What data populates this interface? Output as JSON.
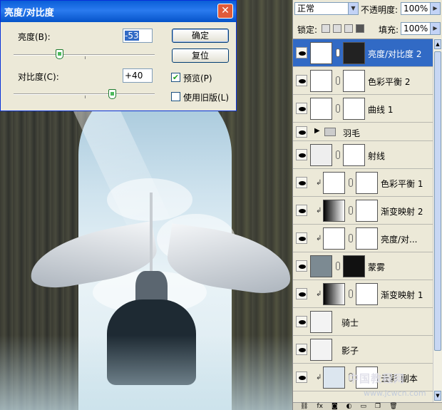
{
  "dialog": {
    "title": "亮度/对比度",
    "close_glyph": "✕",
    "brightness_label": "亮度(B):",
    "brightness_value": "-53",
    "contrast_label": "对比度(C):",
    "contrast_value": "+40",
    "ok_label": "确定",
    "reset_label": "复位",
    "preview_label": "预览(P)",
    "preview_checked": true,
    "legacy_label": "使用旧版(L)",
    "legacy_checked": false
  },
  "layers_panel": {
    "blend_mode": "正常",
    "opacity_label": "不透明度:",
    "opacity_value": "100%",
    "lock_label": "锁定:",
    "fill_label": "填充:",
    "fill_value": "100%",
    "layers": [
      {
        "name": "亮度/对比度 2",
        "active": true,
        "clipped": false,
        "has_mask": true
      },
      {
        "name": "色彩平衡 2",
        "active": false,
        "clipped": false,
        "has_mask": true
      },
      {
        "name": "曲线 1",
        "active": false,
        "clipped": false,
        "has_mask": true
      },
      {
        "name": "羽毛",
        "active": false,
        "group": true
      },
      {
        "name": "射线",
        "active": false,
        "clipped": false,
        "has_mask": true
      },
      {
        "name": "色彩平衡 1",
        "active": false,
        "clipped": true,
        "has_mask": true
      },
      {
        "name": "渐变映射 2",
        "active": false,
        "clipped": true,
        "has_mask": true
      },
      {
        "name": "亮度/对...",
        "active": false,
        "clipped": true,
        "has_mask": true
      },
      {
        "name": "蒙雾",
        "active": false,
        "clipped": false,
        "has_mask": true
      },
      {
        "name": "渐变映射 1",
        "active": false,
        "clipped": true,
        "has_mask": true
      },
      {
        "name": "骑士",
        "active": false,
        "clipped": false,
        "has_mask": false
      },
      {
        "name": "影子",
        "active": false,
        "clipped": false,
        "has_mask": false
      },
      {
        "name": "云彩 副本",
        "active": false,
        "clipped": true,
        "has_mask": true
      }
    ],
    "footer_icons": [
      "link-icon",
      "fx-icon",
      "mask-icon",
      "adjustment-icon",
      "folder-icon",
      "new-layer-icon",
      "trash-icon"
    ]
  },
  "watermark": {
    "line1": "中国教程网",
    "line2": "www.jcwcn.com"
  }
}
